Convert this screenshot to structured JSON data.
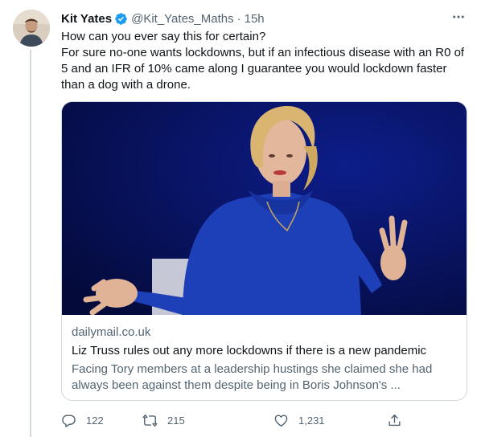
{
  "tweet": {
    "author_name": "Kit Yates",
    "handle": "@Kit_Yates_Maths",
    "separator": "·",
    "time": "15h",
    "text_lines": [
      "How can you ever say this for certain?",
      "For sure no-one wants lockdowns, but if an infectious disease with an R0 of 5 and an IFR of 10% came along I guarantee you would lockdown faster than a dog with a drone."
    ]
  },
  "card": {
    "domain": "dailymail.co.uk",
    "title": "Liz Truss rules out any more lockdowns if there is a new pandemic",
    "description": "Facing Tory members at a leadership hustings she claimed she had always been against them despite being in Boris Johnson's ..."
  },
  "actions": {
    "replies": "122",
    "retweets": "215",
    "likes": "1,231"
  },
  "colors": {
    "verified_blue": "#1d9bf0",
    "secondary_text": "#536471",
    "border": "#cfd9de"
  }
}
